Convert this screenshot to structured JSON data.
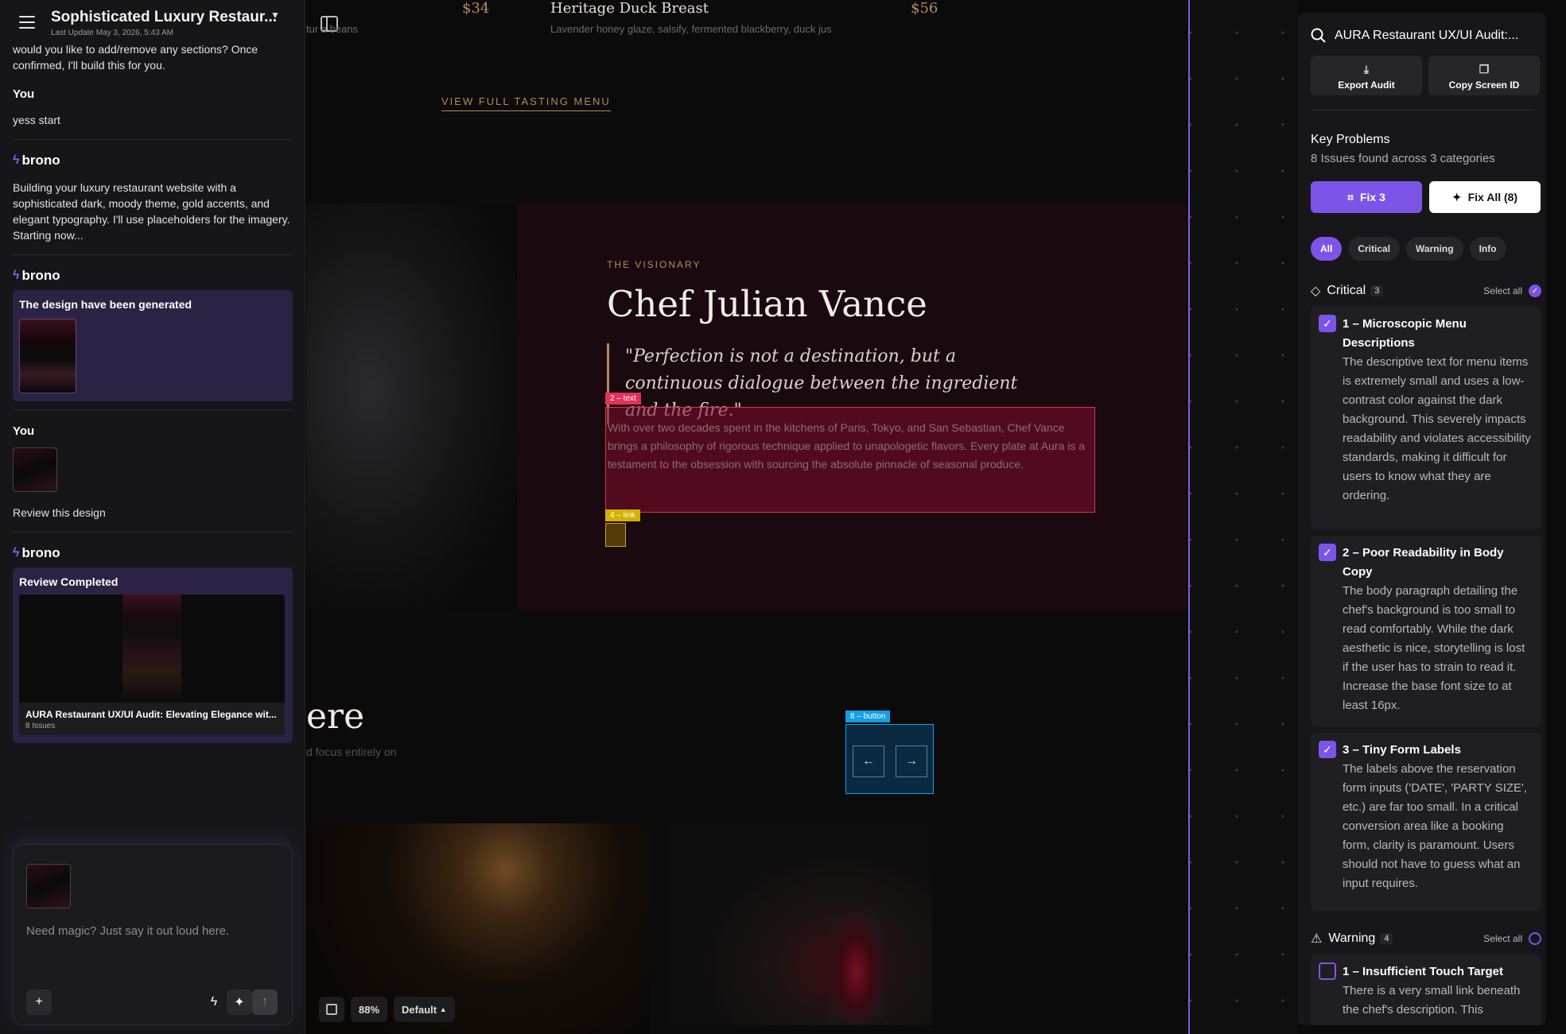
{
  "project": {
    "title": "Sophisticated Luxury Restaur...",
    "last_update": "Last Update May 3, 2026, 5:43 AM"
  },
  "chat": {
    "partial_text": "would you like to add/remove any sections? Once confirmed, I'll build this for you.",
    "user_label": "You",
    "user_msg_1": "yess start",
    "brand": "brono",
    "bot_msg_1": "Building your luxury restaurant website with a sophisticated dark, moody theme, gold accents, and elegant typography. I'll use placeholders for the imagery. Starting now...",
    "generated_card_title": "The design have been generated",
    "user_msg_2": "Review this design",
    "review_card_title": "Review Completed",
    "review_title": "AURA Restaurant UX/UI Audit: Elevating Elegance wit...",
    "review_issues": "8 Issues",
    "composer_placeholder": "Need magic? Just say it out loud here."
  },
  "canvas": {
    "menu_price_1": "$34",
    "menu_partial": "tur a beans",
    "menu_item_2": "Heritage Duck Breast",
    "menu_price_2": "$56",
    "menu_desc_2": "Lavender honey glaze, salsify, fermented blackberry, duck jus",
    "tasting_link": "VIEW FULL TASTING MENU",
    "eyebrow": "THE VISIONARY",
    "chef_name": "Chef Julian Vance",
    "quote": "\"Perfection is not a destination, but a continuous dialogue between the ingredient and the fire.\"",
    "bio": "With over two decades spent in the kitchens of Paris, Tokyo, and San Sebastian, Chef Vance brings a philosophy of rigorous technique applied to unapologetic flavors. Every plate at Aura is a testament to the obsession with sourcing the absolute pinnacle of seasonal produce.",
    "tag_text": "2 – text",
    "tag_link": "4 – link",
    "tag_button": "8 – button",
    "heading_partial": "ere",
    "sub_partial": "d focus entirely on",
    "zoom": "88%",
    "view_mode": "Default",
    "highlight_colors": {
      "text": "#e0325a",
      "link": "#d4b000",
      "button": "#12a0e6"
    }
  },
  "audit": {
    "search_title": "AURA Restaurant UX/UI Audit:...",
    "export_label": "Export Audit",
    "copy_label": "Copy Screen ID",
    "key_problems": "Key Problems",
    "summary": "8 Issues found across 3 categories",
    "fix_selected": "Fix 3",
    "fix_all": "Fix All (8)",
    "filters": [
      "All",
      "Critical",
      "Warning",
      "Info"
    ],
    "select_all": "Select all",
    "critical": {
      "name": "Critical",
      "count": "3",
      "issues": [
        {
          "title": "1 – Microscopic Menu Descriptions",
          "desc": "The descriptive text for menu items is extremely small and uses a low-contrast color against the dark background. This severely impacts readability and violates accessibility standards, making it difficult for users to know what they are ordering."
        },
        {
          "title": "2 – Poor Readability in Body Copy",
          "desc": "The body paragraph detailing the chef's background is too small to read comfortably. While the dark aesthetic is nice, storytelling is lost if the user has to strain to read it. Increase the base font size to at least 16px."
        },
        {
          "title": "3 – Tiny Form Labels",
          "desc": "The labels above the reservation form inputs ('DATE', 'PARTY SIZE', etc.) are far too small. In a critical conversion area like a booking form, clarity is paramount. Users should not have to guess what an input requires."
        }
      ]
    },
    "warning": {
      "name": "Warning",
      "count": "4",
      "issues": [
        {
          "title": "1 – Insufficient Touch Target",
          "desc": "There is a very small link beneath the chef's description. This"
        }
      ]
    },
    "accent_color": "#7c55e8"
  }
}
